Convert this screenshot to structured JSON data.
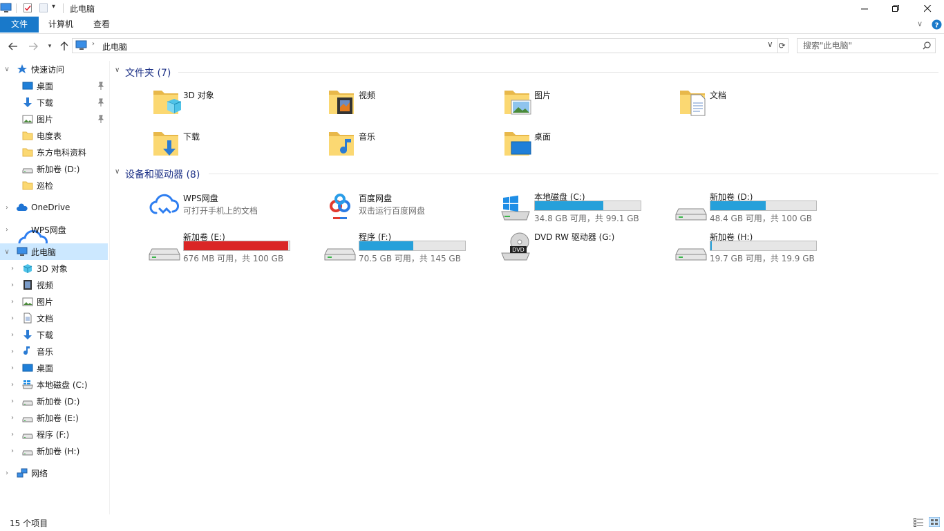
{
  "window": {
    "title": "此电脑"
  },
  "ribbon": {
    "tabs": [
      {
        "label": "文件",
        "active": true
      },
      {
        "label": "计算机",
        "active": false
      },
      {
        "label": "查看",
        "active": false
      }
    ]
  },
  "address": {
    "path": "此电脑",
    "search_placeholder": "搜索\"此电脑\""
  },
  "sidebar": {
    "items": [
      {
        "label": "快速访问",
        "icon": "star-icon",
        "pinned": false
      },
      {
        "label": "桌面",
        "icon": "desktop-icon",
        "pinned": true
      },
      {
        "label": "下载",
        "icon": "download-arrow-icon",
        "pinned": true
      },
      {
        "label": "图片",
        "icon": "pictures-icon",
        "pinned": true
      },
      {
        "label": "电度表",
        "icon": "folder-icon",
        "pinned": false
      },
      {
        "label": "东方电科资料",
        "icon": "folder-icon",
        "pinned": false
      },
      {
        "label": "新加卷 (D:)",
        "icon": "drive-icon",
        "pinned": false
      },
      {
        "label": "巡检",
        "icon": "folder-icon",
        "pinned": false
      },
      {
        "label": "OneDrive",
        "icon": "onedrive-cloud-icon",
        "pinned": false
      },
      {
        "label": "WPS网盘",
        "icon": "wps-cloud-icon",
        "pinned": false
      },
      {
        "label": "此电脑",
        "icon": "computer-icon",
        "pinned": false
      },
      {
        "label": "3D 对象",
        "icon": "3d-objects-icon",
        "pinned": false
      },
      {
        "label": "视频",
        "icon": "video-icon",
        "pinned": false
      },
      {
        "label": "图片",
        "icon": "pictures-icon",
        "pinned": false
      },
      {
        "label": "文档",
        "icon": "documents-icon",
        "pinned": false
      },
      {
        "label": "下载",
        "icon": "download-arrow-icon",
        "pinned": false
      },
      {
        "label": "音乐",
        "icon": "music-note-icon",
        "pinned": false
      },
      {
        "label": "桌面",
        "icon": "desktop-icon",
        "pinned": false
      },
      {
        "label": "本地磁盘 (C:)",
        "icon": "windows-drive-icon",
        "pinned": false
      },
      {
        "label": "新加卷 (D:)",
        "icon": "drive-icon",
        "pinned": false
      },
      {
        "label": "新加卷 (E:)",
        "icon": "drive-icon",
        "pinned": false
      },
      {
        "label": "程序 (F:)",
        "icon": "drive-icon",
        "pinned": false
      },
      {
        "label": "新加卷 (H:)",
        "icon": "drive-icon",
        "pinned": false
      },
      {
        "label": "网络",
        "icon": "network-icon",
        "pinned": false
      }
    ]
  },
  "folders": {
    "header": "文件夹 (7)",
    "items": [
      {
        "label": "3D 对象",
        "icon": "3d-objects-folder-icon"
      },
      {
        "label": "视频",
        "icon": "video-folder-icon"
      },
      {
        "label": "图片",
        "icon": "pictures-folder-icon"
      },
      {
        "label": "文档",
        "icon": "documents-folder-icon"
      },
      {
        "label": "下载",
        "icon": "downloads-folder-icon"
      },
      {
        "label": "音乐",
        "icon": "music-folder-icon"
      },
      {
        "label": "桌面",
        "icon": "desktop-folder-icon"
      }
    ]
  },
  "devices": {
    "header": "设备和驱动器 (8)",
    "items": [
      {
        "label": "WPS网盘",
        "sub": "可打开手机上的文档",
        "icon": "wps-cloud-icon",
        "used_fraction": null
      },
      {
        "label": "百度网盘",
        "sub": "双击运行百度网盘",
        "icon": "baidu-netdisk-icon",
        "used_fraction": null
      },
      {
        "label": "本地磁盘 (C:)",
        "sub": "34.8 GB 可用，共 99.1 GB",
        "icon": "windows-drive-icon",
        "used_fraction": 0.649
      },
      {
        "label": "新加卷 (D:)",
        "sub": "48.4 GB 可用，共 100 GB",
        "icon": "drive-icon",
        "used_fraction": 0.516
      },
      {
        "label": "新加卷 (E:)",
        "sub": "676 MB 可用，共 100 GB",
        "icon": "drive-icon",
        "used_fraction": 0.993
      },
      {
        "label": "程序 (F:)",
        "sub": "70.5 GB 可用，共 145 GB",
        "icon": "drive-icon",
        "used_fraction": 0.514
      },
      {
        "label": "DVD RW 驱动器 (G:)",
        "sub": "",
        "icon": "dvd-drive-icon",
        "used_fraction": null
      },
      {
        "label": "新加卷 (H:)",
        "sub": "19.7 GB 可用，共 19.9 GB",
        "icon": "drive-icon",
        "used_fraction": 0.01
      }
    ]
  },
  "status": {
    "text": "15 个项目"
  },
  "colors": {
    "accent": "#1979ca",
    "bar_normal": "#26a0da",
    "bar_full": "#da2626",
    "selected_bg": "#cce8ff",
    "group_header": "#1e3287"
  }
}
